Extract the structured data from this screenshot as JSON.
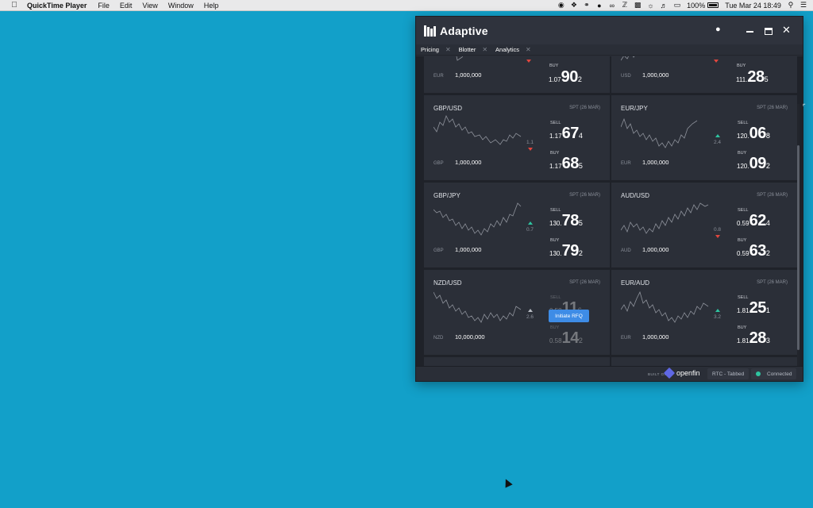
{
  "menubar": {
    "app_name": "QuickTime Player",
    "items": [
      "File",
      "Edit",
      "View",
      "Window",
      "Help"
    ],
    "battery": "100%",
    "datetime": "Tue Mar 24  18:49"
  },
  "window": {
    "title": "Adaptive",
    "tabs": [
      {
        "label": "Pricing"
      },
      {
        "label": "Blotter"
      },
      {
        "label": "Analytics"
      }
    ]
  },
  "tiles": [
    {
      "pair": "",
      "spt": "",
      "ccy": "EUR",
      "notional": "1,000,000",
      "movement": "",
      "direction": "down",
      "sell": {
        "label": "SELL",
        "pre": "",
        "mid": "",
        "pip": ""
      },
      "buy": {
        "label": "BUY",
        "pre": "1.07",
        "mid": "90",
        "pip": "2"
      }
    },
    {
      "pair": "",
      "spt": "",
      "ccy": "USD",
      "notional": "1,000,000",
      "movement": "",
      "direction": "down",
      "sell": {
        "label": "SELL",
        "pre": "",
        "mid": "",
        "pip": ""
      },
      "buy": {
        "label": "BUY",
        "pre": "111.",
        "mid": "28",
        "pip": "5"
      }
    },
    {
      "pair": "GBP/USD",
      "spt": "SPT (26 MAR)",
      "ccy": "GBP",
      "notional": "1,000,000",
      "movement": "1.1",
      "direction": "down",
      "sell": {
        "label": "SELL",
        "pre": "1.17",
        "mid": "67",
        "pip": "4"
      },
      "buy": {
        "label": "BUY",
        "pre": "1.17",
        "mid": "68",
        "pip": "5"
      }
    },
    {
      "pair": "EUR/JPY",
      "spt": "SPT (26 MAR)",
      "ccy": "EUR",
      "notional": "1,000,000",
      "movement": "2.4",
      "direction": "up",
      "sell": {
        "label": "SELL",
        "pre": "120.",
        "mid": "06",
        "pip": "8"
      },
      "buy": {
        "label": "BUY",
        "pre": "120.",
        "mid": "09",
        "pip": "2"
      }
    },
    {
      "pair": "GBP/JPY",
      "spt": "SPT (26 MAR)",
      "ccy": "GBP",
      "notional": "1,000,000",
      "movement": "0.7",
      "direction": "up",
      "sell": {
        "label": "SELL",
        "pre": "130.",
        "mid": "78",
        "pip": "5"
      },
      "buy": {
        "label": "BUY",
        "pre": "130.",
        "mid": "79",
        "pip": "2"
      }
    },
    {
      "pair": "AUD/USD",
      "spt": "SPT (26 MAR)",
      "ccy": "AUD",
      "notional": "1,000,000",
      "movement": "0.8",
      "direction": "down",
      "sell": {
        "label": "SELL",
        "pre": "0.59",
        "mid": "62",
        "pip": "4"
      },
      "buy": {
        "label": "BUY",
        "pre": "0.59",
        "mid": "63",
        "pip": "2"
      }
    },
    {
      "pair": "NZD/USD",
      "spt": "SPT (26 MAR)",
      "ccy": "NZD",
      "notional": "10,000,000",
      "movement": "2.6",
      "direction": "neutral",
      "sell": {
        "label": "SELL",
        "pre": "0.58",
        "mid": "11",
        "pip": "6"
      },
      "buy": {
        "label": "BUY",
        "pre": "0.58",
        "mid": "14",
        "pip": "2"
      },
      "rfq_label": "Initiate RFQ"
    },
    {
      "pair": "EUR/AUD",
      "spt": "SPT (26 MAR)",
      "ccy": "EUR",
      "notional": "1,000,000",
      "movement": "3.2",
      "direction": "up",
      "sell": {
        "label": "SELL",
        "pre": "1.81",
        "mid": "25",
        "pip": "1"
      },
      "buy": {
        "label": "BUY",
        "pre": "1.81",
        "mid": "28",
        "pip": "3"
      }
    }
  ],
  "statusbar": {
    "built_on": "BUILT ON",
    "brand": "openfin",
    "mode": "RTC - Tabbed",
    "connection": "Connected"
  },
  "colors": {
    "desktop": "#12a0c9",
    "up": "#2ec4a0",
    "down": "#e0463e",
    "rfq": "#3e8ce6"
  }
}
